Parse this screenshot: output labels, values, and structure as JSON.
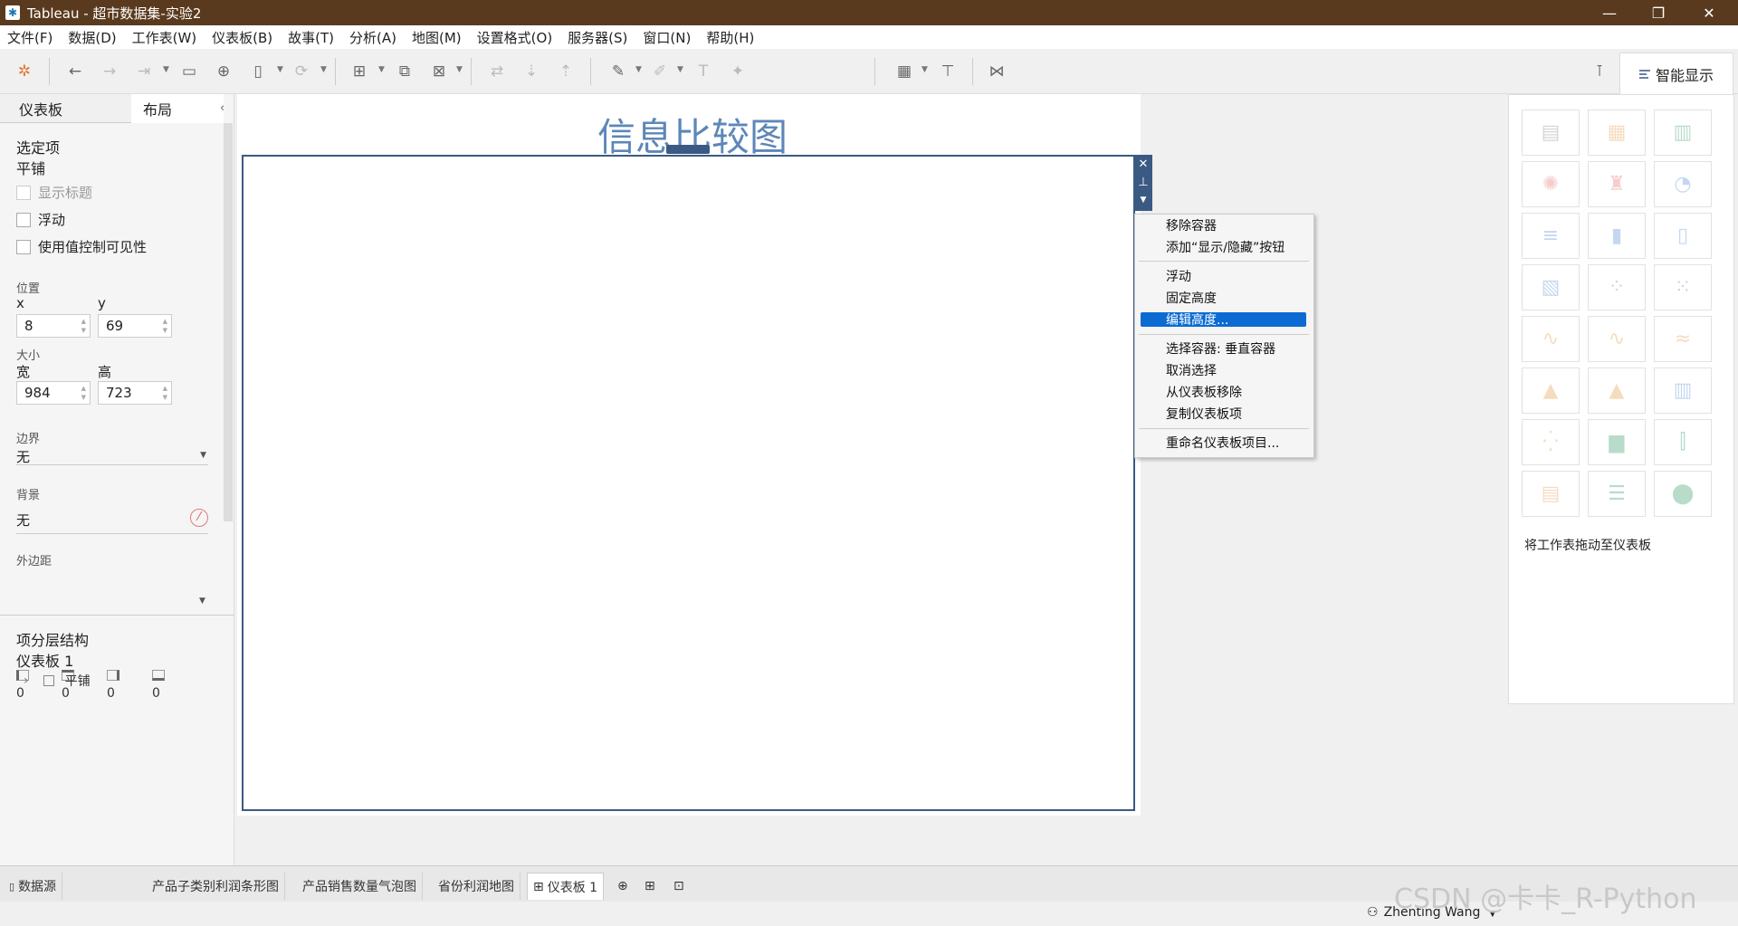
{
  "window": {
    "title": "Tableau - 超市数据集-实验2",
    "minimize": "—",
    "maximize": "❐",
    "close": "✕"
  },
  "menu": [
    "文件(F)",
    "数据(D)",
    "工作表(W)",
    "仪表板(B)",
    "故事(T)",
    "分析(A)",
    "地图(M)",
    "设置格式(O)",
    "服务器(S)",
    "窗口(N)",
    "帮助(H)"
  ],
  "smart_show": {
    "label": "智能显示",
    "hint": "将工作表拖动至仪表板"
  },
  "left_panel": {
    "tabs": [
      "仪表板",
      "布局"
    ],
    "selected_label": "选定项",
    "selected_value": "平铺",
    "checkboxes": [
      "显示标题",
      "浮动",
      "使用值控制可见性"
    ],
    "position_label": "位置",
    "x_label": "x",
    "x_value": "8",
    "y_label": "y",
    "y_value": "69",
    "size_label": "大小",
    "w_label": "宽",
    "w_value": "984",
    "h_label": "高",
    "h_value": "723",
    "border_label": "边界",
    "border_value": "无",
    "bg_label": "背景",
    "bg_value": "无",
    "margin_label": "外边距",
    "margins": [
      "0",
      "0",
      "0",
      "0"
    ],
    "hier_label": "项分层结构",
    "hier_root": "仪表板 1",
    "hier_child": "平铺"
  },
  "dashboard": {
    "title": "信息比较图"
  },
  "context_menu": {
    "items": [
      "移除容器",
      "添加“显示/隐藏”按钮",
      "浮动",
      "固定高度",
      "编辑高度...",
      "选择容器: 垂直容器",
      "取消选择",
      "从仪表板移除",
      "复制仪表板项",
      "重命名仪表板项目..."
    ],
    "highlighted": "编辑高度..."
  },
  "sheet_tabs": {
    "datasource": "数据源",
    "tabs": [
      "产品子类别利润条形图",
      "产品销售数量气泡图",
      "省份利润地图",
      "仪表板 1"
    ],
    "active": "仪表板 1"
  },
  "status": {
    "user": "Zhenting Wang"
  },
  "watermark": "CSDN @卡卡_R-Python",
  "icons": [
    "tableau-logo-icon",
    "undo-icon",
    "redo-icon",
    "save-icon",
    "new-datasource-icon",
    "new-sheet-icon",
    "duplicate-icon",
    "clear-icon",
    "swap-icon",
    "sort-asc-icon",
    "sort-desc-icon",
    "highlight-icon",
    "annotate-icon",
    "text-icon",
    "pin-icon",
    "chart-icon",
    "presentation-icon",
    "share-icon"
  ]
}
